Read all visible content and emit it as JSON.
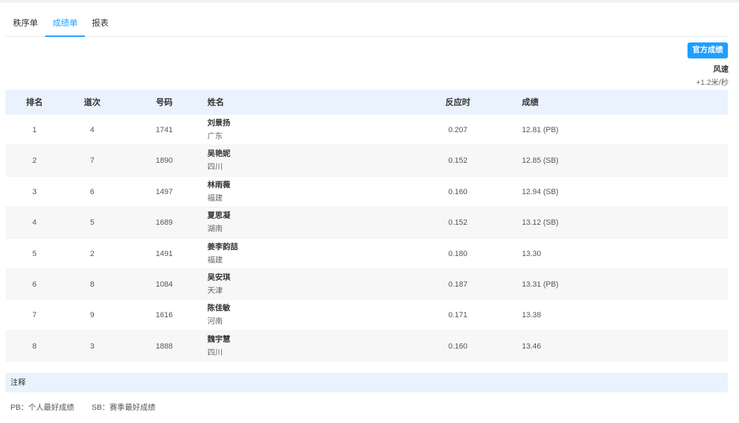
{
  "tabs": [
    "秩序单",
    "成绩单",
    "报表"
  ],
  "active_tab": 1,
  "official_button": "官方成绩",
  "wind": {
    "label": "风速",
    "value": "+1.2米/秒"
  },
  "table": {
    "headers": {
      "rank": "排名",
      "lane": "道次",
      "bib": "号码",
      "name": "姓名",
      "reaction": "反应时",
      "result": "成绩"
    },
    "rows": [
      {
        "rank": "1",
        "lane": "4",
        "bib": "1741",
        "name": "刘景扬",
        "province": "广东",
        "reaction": "0.207",
        "result": "12.81  (PB)"
      },
      {
        "rank": "2",
        "lane": "7",
        "bib": "1890",
        "name": "吴艳妮",
        "province": "四川",
        "reaction": "0.152",
        "result": "12.85  (SB)"
      },
      {
        "rank": "3",
        "lane": "6",
        "bib": "1497",
        "name": "林雨薇",
        "province": "福建",
        "reaction": "0.160",
        "result": "12.94  (SB)"
      },
      {
        "rank": "4",
        "lane": "5",
        "bib": "1689",
        "name": "夏思凝",
        "province": "湖南",
        "reaction": "0.152",
        "result": "13.12  (SB)"
      },
      {
        "rank": "5",
        "lane": "2",
        "bib": "1491",
        "name": "姜李韵喆",
        "province": "福建",
        "reaction": "0.180",
        "result": "13.30"
      },
      {
        "rank": "6",
        "lane": "8",
        "bib": "1084",
        "name": "吴安琪",
        "province": "天津",
        "reaction": "0.187",
        "result": "13.31  (PB)"
      },
      {
        "rank": "7",
        "lane": "9",
        "bib": "1616",
        "name": "陈佳敏",
        "province": "河南",
        "reaction": "0.171",
        "result": "13.38"
      },
      {
        "rank": "8",
        "lane": "3",
        "bib": "1888",
        "name": "魏宇慧",
        "province": "四川",
        "reaction": "0.160",
        "result": "13.46"
      }
    ]
  },
  "notes": {
    "title": "注释",
    "items": [
      "PB：个人最好成绩",
      "SB：赛季最好成绩"
    ]
  },
  "colors": {
    "accent": "#1e9fff",
    "header_bg": "#eaf3fd",
    "stripe": "#f7f7f7"
  }
}
